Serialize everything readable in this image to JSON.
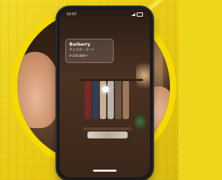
{
  "status_bar": {
    "time": "10:07"
  },
  "ar_card": {
    "brand": "Burberry",
    "product_name": "チェスターコート",
    "price": "¥ 250,000〜"
  },
  "colors": {
    "accent": "#f5da00",
    "background": "#efd51c"
  }
}
